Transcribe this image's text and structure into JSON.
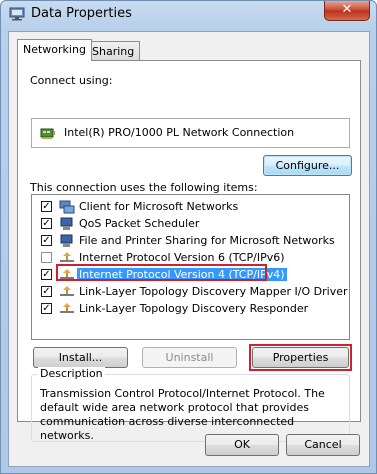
{
  "window": {
    "title": "Data Properties",
    "close_label": "✕"
  },
  "tabs": [
    {
      "label": "Networking",
      "active": true
    },
    {
      "label": "Sharing",
      "active": false
    }
  ],
  "networking": {
    "connect_using_label": "Connect using:",
    "adapter_name": "Intel(R) PRO/1000 PL Network Connection",
    "configure_label": "Configure...",
    "items_label": "This connection uses the following items:",
    "items": [
      {
        "label": "Client for Microsoft Networks",
        "checked": true,
        "icon": "network-client-icon"
      },
      {
        "label": "QoS Packet Scheduler",
        "checked": true,
        "icon": "network-service-icon"
      },
      {
        "label": "File and Printer Sharing for Microsoft Networks",
        "checked": true,
        "icon": "network-service-icon"
      },
      {
        "label": "Internet Protocol Version 6 (TCP/IPv6)",
        "checked": false,
        "icon": "protocol-icon"
      },
      {
        "label": "Internet Protocol Version 4 (TCP/IPv4)",
        "checked": true,
        "icon": "protocol-icon",
        "selected": true
      },
      {
        "label": "Link-Layer Topology Discovery Mapper I/O Driver",
        "checked": true,
        "icon": "protocol-icon"
      },
      {
        "label": "Link-Layer Topology Discovery Responder",
        "checked": true,
        "icon": "protocol-icon"
      }
    ],
    "install_label": "Install...",
    "uninstall_label": "Uninstall",
    "properties_label": "Properties",
    "description_title": "Description",
    "description_text": "Transmission Control Protocol/Internet Protocol. The default wide area network protocol that provides communication across diverse interconnected networks."
  },
  "footer": {
    "ok_label": "OK",
    "cancel_label": "Cancel"
  },
  "colors": {
    "selection": "#3399ff",
    "highlight_outline": "#d0202e",
    "title_gradient": "#b8d0ea"
  }
}
